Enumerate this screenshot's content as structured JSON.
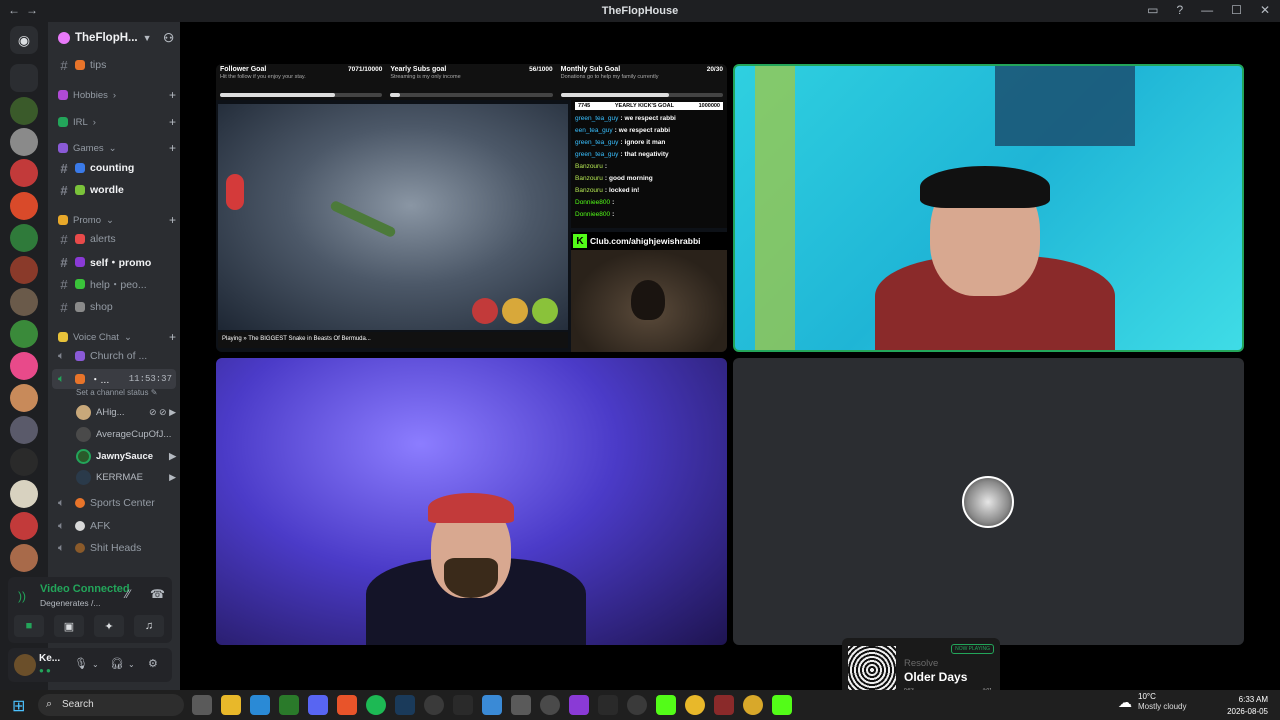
{
  "window": {
    "title": "TheFlopHouse"
  },
  "server": {
    "name": "TheFlopH..."
  },
  "channels": {
    "tips": "tips",
    "cat_hobbies": "Hobbies",
    "cat_irl": "IRL",
    "cat_games": "Games",
    "counting": "counting",
    "wordle": "wordle",
    "cat_promo": "Promo",
    "alerts": "alerts",
    "self_promo": "self・promo",
    "help": "help・peo...",
    "shop": "shop",
    "cat_voice": "Voice Chat",
    "church": "Church of ...",
    "active_voice": "・...",
    "active_timer": "11:53:37",
    "status_hint": "Set a channel status",
    "sports": "Sports Center",
    "afk": "AFK",
    "shit_heads": "Shit Heads"
  },
  "voice_users": [
    {
      "name": "AHig..."
    },
    {
      "name": "AverageCupOfJ..."
    },
    {
      "name": "JawnySauce"
    },
    {
      "name": "KERRMAE"
    }
  ],
  "voice_panel": {
    "status": "Video Connected",
    "subtitle": "Degenerates /..."
  },
  "user_panel": {
    "name": "Ke..."
  },
  "stream": {
    "goals": [
      {
        "title": "Follower Goal",
        "value": "7071/10000",
        "desc": "Hit the follow if you enjoy your stay.",
        "sub": "7071/10000",
        "progress": 0.71
      },
      {
        "title": "Yearly Subs goal",
        "value": "56/1000",
        "desc": "Streaming is my only income",
        "sub": "56/1000",
        "progress": 0.06
      },
      {
        "title": "Monthly Sub Goal",
        "value": "20/30",
        "desc": "Donations go to help my family currently",
        "sub": "20/30",
        "progress": 0.67
      }
    ],
    "chat_header_left": "7745",
    "chat_header_mid": "YEARLY KICK'S GOAL",
    "chat_header_right": "1000000",
    "chat": [
      {
        "user": "green_tea_guy",
        "text": "we respect rabbi"
      },
      {
        "user": "een_tea_guy",
        "text": "we respect rabbi"
      },
      {
        "user": "green_tea_guy",
        "text": "ignore it man"
      },
      {
        "user": "green_tea_guy",
        "text": "that negativity"
      },
      {
        "user": "Banzouru",
        "text": ""
      },
      {
        "user": "Banzouru",
        "text": "good morning"
      },
      {
        "user": "Banzouru",
        "text": "locked in!"
      },
      {
        "user": "Donniee800",
        "text": ""
      },
      {
        "user": "Donniee800",
        "text": ""
      }
    ],
    "kick_url": "Club.com/ahighjewishrabbi",
    "video_caption": "Playing » The BIGGEST Snake in Beasts Of Bermuda..."
  },
  "now_playing": {
    "tag": "NOW PLAYING",
    "artist": "Resolve",
    "song": "Older Days",
    "elapsed": "0:53",
    "duration": "4:01"
  },
  "taskbar": {
    "search": "Search",
    "temp": "10°C",
    "weather": "Mostly cloudy",
    "time": "6:33 AM",
    "date": "2026-08-05"
  },
  "colors": {
    "accent_green": "#23a55a",
    "discord_bg": "#2b2d31",
    "kick_green": "#53fc18"
  }
}
